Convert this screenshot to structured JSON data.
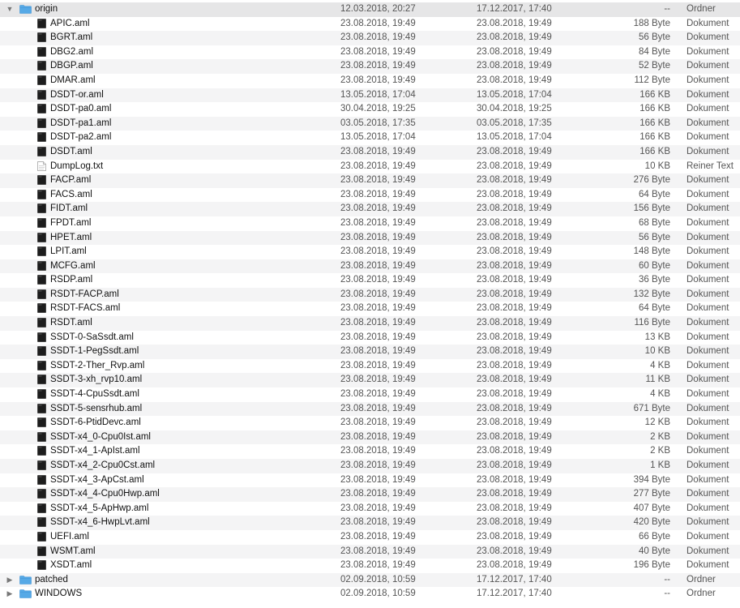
{
  "rows": [
    {
      "depth": 0,
      "type": "folder",
      "expanded": true,
      "name": "origin",
      "modified": "12.03.2018, 20:27",
      "created": "17.12.2017, 17:40",
      "size": "--",
      "kind": "Ordner"
    },
    {
      "depth": 1,
      "type": "aml",
      "name": "APIC.aml",
      "modified": "23.08.2018, 19:49",
      "created": "23.08.2018, 19:49",
      "size": "188 Byte",
      "kind": "Dokument"
    },
    {
      "depth": 1,
      "type": "aml",
      "name": "BGRT.aml",
      "modified": "23.08.2018, 19:49",
      "created": "23.08.2018, 19:49",
      "size": "56 Byte",
      "kind": "Dokument"
    },
    {
      "depth": 1,
      "type": "aml",
      "name": "DBG2.aml",
      "modified": "23.08.2018, 19:49",
      "created": "23.08.2018, 19:49",
      "size": "84 Byte",
      "kind": "Dokument"
    },
    {
      "depth": 1,
      "type": "aml",
      "name": "DBGP.aml",
      "modified": "23.08.2018, 19:49",
      "created": "23.08.2018, 19:49",
      "size": "52 Byte",
      "kind": "Dokument"
    },
    {
      "depth": 1,
      "type": "aml",
      "name": "DMAR.aml",
      "modified": "23.08.2018, 19:49",
      "created": "23.08.2018, 19:49",
      "size": "112 Byte",
      "kind": "Dokument"
    },
    {
      "depth": 1,
      "type": "aml",
      "name": "DSDT-or.aml",
      "modified": "13.05.2018, 17:04",
      "created": "13.05.2018, 17:04",
      "size": "166 KB",
      "kind": "Dokument"
    },
    {
      "depth": 1,
      "type": "aml",
      "name": "DSDT-pa0.aml",
      "modified": "30.04.2018, 19:25",
      "created": "30.04.2018, 19:25",
      "size": "166 KB",
      "kind": "Dokument"
    },
    {
      "depth": 1,
      "type": "aml",
      "name": "DSDT-pa1.aml",
      "modified": "03.05.2018, 17:35",
      "created": "03.05.2018, 17:35",
      "size": "166 KB",
      "kind": "Dokument"
    },
    {
      "depth": 1,
      "type": "aml",
      "name": "DSDT-pa2.aml",
      "modified": "13.05.2018, 17:04",
      "created": "13.05.2018, 17:04",
      "size": "166 KB",
      "kind": "Dokument"
    },
    {
      "depth": 1,
      "type": "aml",
      "name": "DSDT.aml",
      "modified": "23.08.2018, 19:49",
      "created": "23.08.2018, 19:49",
      "size": "166 KB",
      "kind": "Dokument"
    },
    {
      "depth": 1,
      "type": "txt",
      "name": "DumpLog.txt",
      "modified": "23.08.2018, 19:49",
      "created": "23.08.2018, 19:49",
      "size": "10 KB",
      "kind": "Reiner Text"
    },
    {
      "depth": 1,
      "type": "aml",
      "name": "FACP.aml",
      "modified": "23.08.2018, 19:49",
      "created": "23.08.2018, 19:49",
      "size": "276 Byte",
      "kind": "Dokument"
    },
    {
      "depth": 1,
      "type": "aml",
      "name": "FACS.aml",
      "modified": "23.08.2018, 19:49",
      "created": "23.08.2018, 19:49",
      "size": "64 Byte",
      "kind": "Dokument"
    },
    {
      "depth": 1,
      "type": "aml",
      "name": "FIDT.aml",
      "modified": "23.08.2018, 19:49",
      "created": "23.08.2018, 19:49",
      "size": "156 Byte",
      "kind": "Dokument"
    },
    {
      "depth": 1,
      "type": "aml",
      "name": "FPDT.aml",
      "modified": "23.08.2018, 19:49",
      "created": "23.08.2018, 19:49",
      "size": "68 Byte",
      "kind": "Dokument"
    },
    {
      "depth": 1,
      "type": "aml",
      "name": "HPET.aml",
      "modified": "23.08.2018, 19:49",
      "created": "23.08.2018, 19:49",
      "size": "56 Byte",
      "kind": "Dokument"
    },
    {
      "depth": 1,
      "type": "aml",
      "name": "LPIT.aml",
      "modified": "23.08.2018, 19:49",
      "created": "23.08.2018, 19:49",
      "size": "148 Byte",
      "kind": "Dokument"
    },
    {
      "depth": 1,
      "type": "aml",
      "name": "MCFG.aml",
      "modified": "23.08.2018, 19:49",
      "created": "23.08.2018, 19:49",
      "size": "60 Byte",
      "kind": "Dokument"
    },
    {
      "depth": 1,
      "type": "aml",
      "name": "RSDP.aml",
      "modified": "23.08.2018, 19:49",
      "created": "23.08.2018, 19:49",
      "size": "36 Byte",
      "kind": "Dokument"
    },
    {
      "depth": 1,
      "type": "aml",
      "name": "RSDT-FACP.aml",
      "modified": "23.08.2018, 19:49",
      "created": "23.08.2018, 19:49",
      "size": "132 Byte",
      "kind": "Dokument"
    },
    {
      "depth": 1,
      "type": "aml",
      "name": "RSDT-FACS.aml",
      "modified": "23.08.2018, 19:49",
      "created": "23.08.2018, 19:49",
      "size": "64 Byte",
      "kind": "Dokument"
    },
    {
      "depth": 1,
      "type": "aml",
      "name": "RSDT.aml",
      "modified": "23.08.2018, 19:49",
      "created": "23.08.2018, 19:49",
      "size": "116 Byte",
      "kind": "Dokument"
    },
    {
      "depth": 1,
      "type": "aml",
      "name": "SSDT-0-SaSsdt.aml",
      "modified": "23.08.2018, 19:49",
      "created": "23.08.2018, 19:49",
      "size": "13 KB",
      "kind": "Dokument"
    },
    {
      "depth": 1,
      "type": "aml",
      "name": "SSDT-1-PegSsdt.aml",
      "modified": "23.08.2018, 19:49",
      "created": "23.08.2018, 19:49",
      "size": "10 KB",
      "kind": "Dokument"
    },
    {
      "depth": 1,
      "type": "aml",
      "name": "SSDT-2-Ther_Rvp.aml",
      "modified": "23.08.2018, 19:49",
      "created": "23.08.2018, 19:49",
      "size": "4 KB",
      "kind": "Dokument"
    },
    {
      "depth": 1,
      "type": "aml",
      "name": "SSDT-3-xh_rvp10.aml",
      "modified": "23.08.2018, 19:49",
      "created": "23.08.2018, 19:49",
      "size": "11 KB",
      "kind": "Dokument"
    },
    {
      "depth": 1,
      "type": "aml",
      "name": "SSDT-4-CpuSsdt.aml",
      "modified": "23.08.2018, 19:49",
      "created": "23.08.2018, 19:49",
      "size": "4 KB",
      "kind": "Dokument"
    },
    {
      "depth": 1,
      "type": "aml",
      "name": "SSDT-5-sensrhub.aml",
      "modified": "23.08.2018, 19:49",
      "created": "23.08.2018, 19:49",
      "size": "671 Byte",
      "kind": "Dokument"
    },
    {
      "depth": 1,
      "type": "aml",
      "name": "SSDT-6-PtidDevc.aml",
      "modified": "23.08.2018, 19:49",
      "created": "23.08.2018, 19:49",
      "size": "12 KB",
      "kind": "Dokument"
    },
    {
      "depth": 1,
      "type": "aml",
      "name": "SSDT-x4_0-Cpu0Ist.aml",
      "modified": "23.08.2018, 19:49",
      "created": "23.08.2018, 19:49",
      "size": "2 KB",
      "kind": "Dokument"
    },
    {
      "depth": 1,
      "type": "aml",
      "name": "SSDT-x4_1-ApIst.aml",
      "modified": "23.08.2018, 19:49",
      "created": "23.08.2018, 19:49",
      "size": "2 KB",
      "kind": "Dokument"
    },
    {
      "depth": 1,
      "type": "aml",
      "name": "SSDT-x4_2-Cpu0Cst.aml",
      "modified": "23.08.2018, 19:49",
      "created": "23.08.2018, 19:49",
      "size": "1 KB",
      "kind": "Dokument"
    },
    {
      "depth": 1,
      "type": "aml",
      "name": "SSDT-x4_3-ApCst.aml",
      "modified": "23.08.2018, 19:49",
      "created": "23.08.2018, 19:49",
      "size": "394 Byte",
      "kind": "Dokument"
    },
    {
      "depth": 1,
      "type": "aml",
      "name": "SSDT-x4_4-Cpu0Hwp.aml",
      "modified": "23.08.2018, 19:49",
      "created": "23.08.2018, 19:49",
      "size": "277 Byte",
      "kind": "Dokument"
    },
    {
      "depth": 1,
      "type": "aml",
      "name": "SSDT-x4_5-ApHwp.aml",
      "modified": "23.08.2018, 19:49",
      "created": "23.08.2018, 19:49",
      "size": "407 Byte",
      "kind": "Dokument"
    },
    {
      "depth": 1,
      "type": "aml",
      "name": "SSDT-x4_6-HwpLvt.aml",
      "modified": "23.08.2018, 19:49",
      "created": "23.08.2018, 19:49",
      "size": "420 Byte",
      "kind": "Dokument"
    },
    {
      "depth": 1,
      "type": "aml",
      "name": "UEFI.aml",
      "modified": "23.08.2018, 19:49",
      "created": "23.08.2018, 19:49",
      "size": "66 Byte",
      "kind": "Dokument"
    },
    {
      "depth": 1,
      "type": "aml",
      "name": "WSMT.aml",
      "modified": "23.08.2018, 19:49",
      "created": "23.08.2018, 19:49",
      "size": "40 Byte",
      "kind": "Dokument"
    },
    {
      "depth": 1,
      "type": "aml",
      "name": "XSDT.aml",
      "modified": "23.08.2018, 19:49",
      "created": "23.08.2018, 19:49",
      "size": "196 Byte",
      "kind": "Dokument"
    },
    {
      "depth": 0,
      "type": "folder",
      "expanded": false,
      "name": "patched",
      "modified": "02.09.2018, 10:59",
      "created": "17.12.2017, 17:40",
      "size": "--",
      "kind": "Ordner"
    },
    {
      "depth": 0,
      "type": "folder",
      "expanded": false,
      "name": "WINDOWS",
      "modified": "02.09.2018, 10:59",
      "created": "17.12.2017, 17:40",
      "size": "--",
      "kind": "Ordner"
    }
  ],
  "colors": {
    "folder": "#56a9e6",
    "folder_tab": "#3f93d6",
    "aml_icon": "#1d1d1d",
    "txt_icon": "#ffffff",
    "stripe": "#f4f4f5",
    "selected": "#e6e6e7"
  },
  "icons": {
    "folder": "folder-icon",
    "aml": "binary-file-icon",
    "txt": "text-file-icon",
    "expanded": "triangle-down-icon",
    "collapsed": "triangle-right-icon"
  }
}
